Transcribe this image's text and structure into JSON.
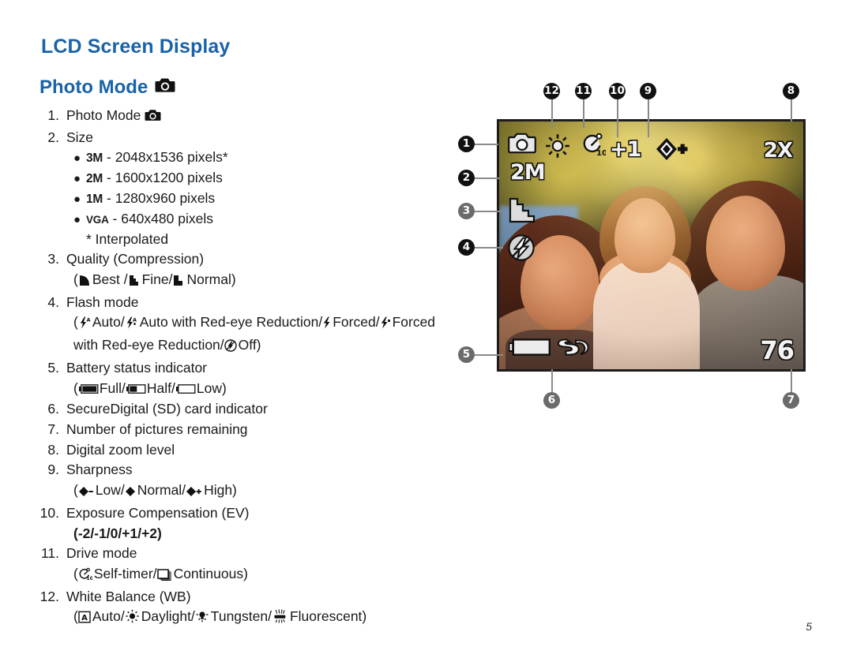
{
  "document": {
    "page_title": "LCD Screen Display",
    "section_title": "Photo Mode",
    "section_title_icon": "camera-icon",
    "page_number": "5",
    "title_color": "#1a63a8"
  },
  "spec_list": [
    {
      "number": "1.",
      "label": "Photo Mode",
      "icon": "camera-icon"
    },
    {
      "number": "2.",
      "label": "Size",
      "bullets": [
        {
          "tag": "3M",
          "text": "- 2048x1536 pixels*"
        },
        {
          "tag": "2M",
          "text": "- 1600x1200 pixels"
        },
        {
          "tag": "1M",
          "text": "- 1280x960 pixels"
        },
        {
          "tag": "VGA",
          "text": "- 640x480 pixels"
        }
      ],
      "footnote": "* Interpolated"
    },
    {
      "number": "3.",
      "label": "Quality (Compression)",
      "detail_open": "(",
      "detail_parts": [
        "Best /",
        "Fine/",
        "Normal)"
      ],
      "detail_icons": [
        "quality-best-icon",
        "quality-fine-icon",
        "quality-normal-icon"
      ]
    },
    {
      "number": "4.",
      "label": "Flash mode",
      "detail_line1_open": "(",
      "detail_line1_parts": [
        "Auto/",
        "Auto with Red-eye Reduction/",
        "Forced/",
        "Forced"
      ],
      "detail_line1_icons": [
        "flash-auto-icon",
        "flash-auto-redeye-icon",
        "flash-forced-icon",
        "flash-forced-redeye-icon"
      ],
      "detail_line2_text": "with Red-eye Reduction/",
      "detail_line2_icon": "flash-off-icon",
      "detail_line2_tail": "Off)"
    },
    {
      "number": "5.",
      "label": "Battery status indicator",
      "detail_open": "(",
      "detail_parts": [
        "Full/",
        "Half/",
        "Low)"
      ],
      "detail_icons": [
        "battery-full-icon",
        "battery-half-icon",
        "battery-low-icon"
      ]
    },
    {
      "number": "6.",
      "label": "SecureDigital (SD) card indicator"
    },
    {
      "number": "7.",
      "label": "Number of pictures remaining"
    },
    {
      "number": "8.",
      "label": "Digital zoom level"
    },
    {
      "number": "9.",
      "label": "Sharpness",
      "detail_open": "(",
      "detail_parts": [
        "Low/",
        "Normal/",
        "High)"
      ],
      "detail_icons": [
        "sharpness-low-icon",
        "sharpness-normal-icon",
        "sharpness-high-icon"
      ]
    },
    {
      "number": "10.",
      "label": "Exposure Compensation (EV)",
      "detail_plain": "(-2/-1/0/+1/+2)"
    },
    {
      "number": "11.",
      "label": "Drive mode",
      "detail_open": "(",
      "detail_parts": [
        "Self-timer/",
        "Continuous)"
      ],
      "detail_icons": [
        "self-timer-icon",
        "continuous-icon"
      ]
    },
    {
      "number": "12.",
      "label": "White Balance (WB)",
      "detail_open": "(",
      "detail_parts": [
        "Auto/",
        "Daylight/",
        "Tungsten/",
        "Fluorescent)"
      ],
      "detail_icons": [
        "wb-auto-icon",
        "wb-daylight-icon",
        "wb-tungsten-icon",
        "wb-fluorescent-icon"
      ]
    }
  ],
  "lcd": {
    "osd": {
      "mode_icon": "photo-mode-camera-icon",
      "white_balance_icon": "wb-daylight-sun-icon",
      "drive_mode_icon": "self-timer-10s-icon",
      "exposure_value": "+1",
      "sharpness_icon": "sharpness-high-diamond-icon",
      "zoom_level": "2X",
      "size": "2M",
      "quality_icon": "quality-best-stairs-icon",
      "flash_icon": "flash-off-icon",
      "battery_icon": "battery-full-icon",
      "sd_icon": "sd-card-icon",
      "pictures_remaining": "76"
    }
  },
  "callouts": [
    {
      "label": "1",
      "style": "dark"
    },
    {
      "label": "2",
      "style": "dark"
    },
    {
      "label": "3",
      "style": "gray"
    },
    {
      "label": "4",
      "style": "dark"
    },
    {
      "label": "5",
      "style": "gray"
    },
    {
      "label": "6",
      "style": "gray"
    },
    {
      "label": "7",
      "style": "gray"
    },
    {
      "label": "8",
      "style": "dark"
    },
    {
      "label": "9",
      "style": "dark"
    },
    {
      "label": "10",
      "style": "dark"
    },
    {
      "label": "11",
      "style": "dark"
    },
    {
      "label": "12",
      "style": "dark"
    }
  ]
}
